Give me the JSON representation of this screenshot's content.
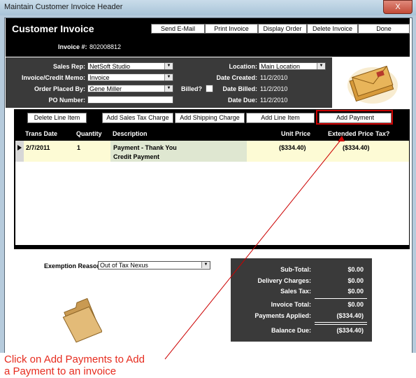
{
  "window": {
    "title": "Maintain Customer Invoice Header",
    "close_label": "X"
  },
  "header": {
    "title": "Customer Invoice",
    "buttons": {
      "send_email": "Send E-Mail",
      "print_invoice": "Print Invoice",
      "display_order": "Display Order",
      "delete_invoice": "Delete Invoice",
      "done": "Done"
    },
    "invoice_label": "Invoice #:",
    "invoice_number": "802008812"
  },
  "info": {
    "sales_rep_label": "Sales Rep:",
    "sales_rep_value": "NetSoft Studio",
    "invoice_memo_label": "Invoice/Credit Memo:",
    "invoice_memo_value": "Invoice",
    "placed_by_label": "Order Placed By:",
    "placed_by_value": "Gene Miller",
    "po_label": "PO Number:",
    "po_value": "",
    "billed_label": "Billed?",
    "location_label": "Location:",
    "location_value": "Main Location",
    "date_created_label": "Date Created:",
    "date_created_value": "11/2/2010",
    "date_billed_label": "Date Billed:",
    "date_billed_value": "11/2/2010",
    "date_due_label": "Date Due:",
    "date_due_value": "11/2/2010"
  },
  "grid_buttons": {
    "delete_line": "Delete Line Item",
    "sales_tax": "Add Sales Tax Charge",
    "shipping": "Add Shipping Charge",
    "line_item": "Add Line Item",
    "payment": "Add Payment"
  },
  "grid": {
    "columns": {
      "trans_date": "Trans Date",
      "quantity": "Quantity",
      "description": "Description",
      "unit_price": "Unit Price",
      "extended_price": "Extended Price",
      "tax": "Tax?"
    },
    "rows": [
      {
        "trans_date": "2/7/2011",
        "quantity": "1",
        "description_line1": "Payment - Thank You",
        "description_line2": "Credit Payment",
        "unit_price": "($334.40)",
        "extended_price": "($334.40)"
      }
    ]
  },
  "exemption": {
    "label": "Exemption Reason:",
    "value": "Out of Tax Nexus"
  },
  "summary": {
    "subtotal_label": "Sub-Total:",
    "subtotal_value": "$0.00",
    "delivery_label": "Delivery Charges:",
    "delivery_value": "$0.00",
    "sales_tax_label": "Sales Tax:",
    "sales_tax_value": "$0.00",
    "invoice_total_label": "Invoice Total:",
    "invoice_total_value": "$0.00",
    "payments_label": "Payments Applied:",
    "payments_value": "($334.40)",
    "balance_label": "Balance Due:",
    "balance_value": "($334.40)"
  },
  "annotation": "Click on Add Payments to Add\na Payment to an invoice",
  "icons": {
    "logo": "envelope-logo",
    "folder": "folder-icon",
    "dropdown": "chevron-down-icon"
  },
  "colors": {
    "header_bg": "#000000",
    "panel_bg": "#3a3a3a",
    "highlight": "#cc0000",
    "row_bg": "#fdfbd5"
  }
}
